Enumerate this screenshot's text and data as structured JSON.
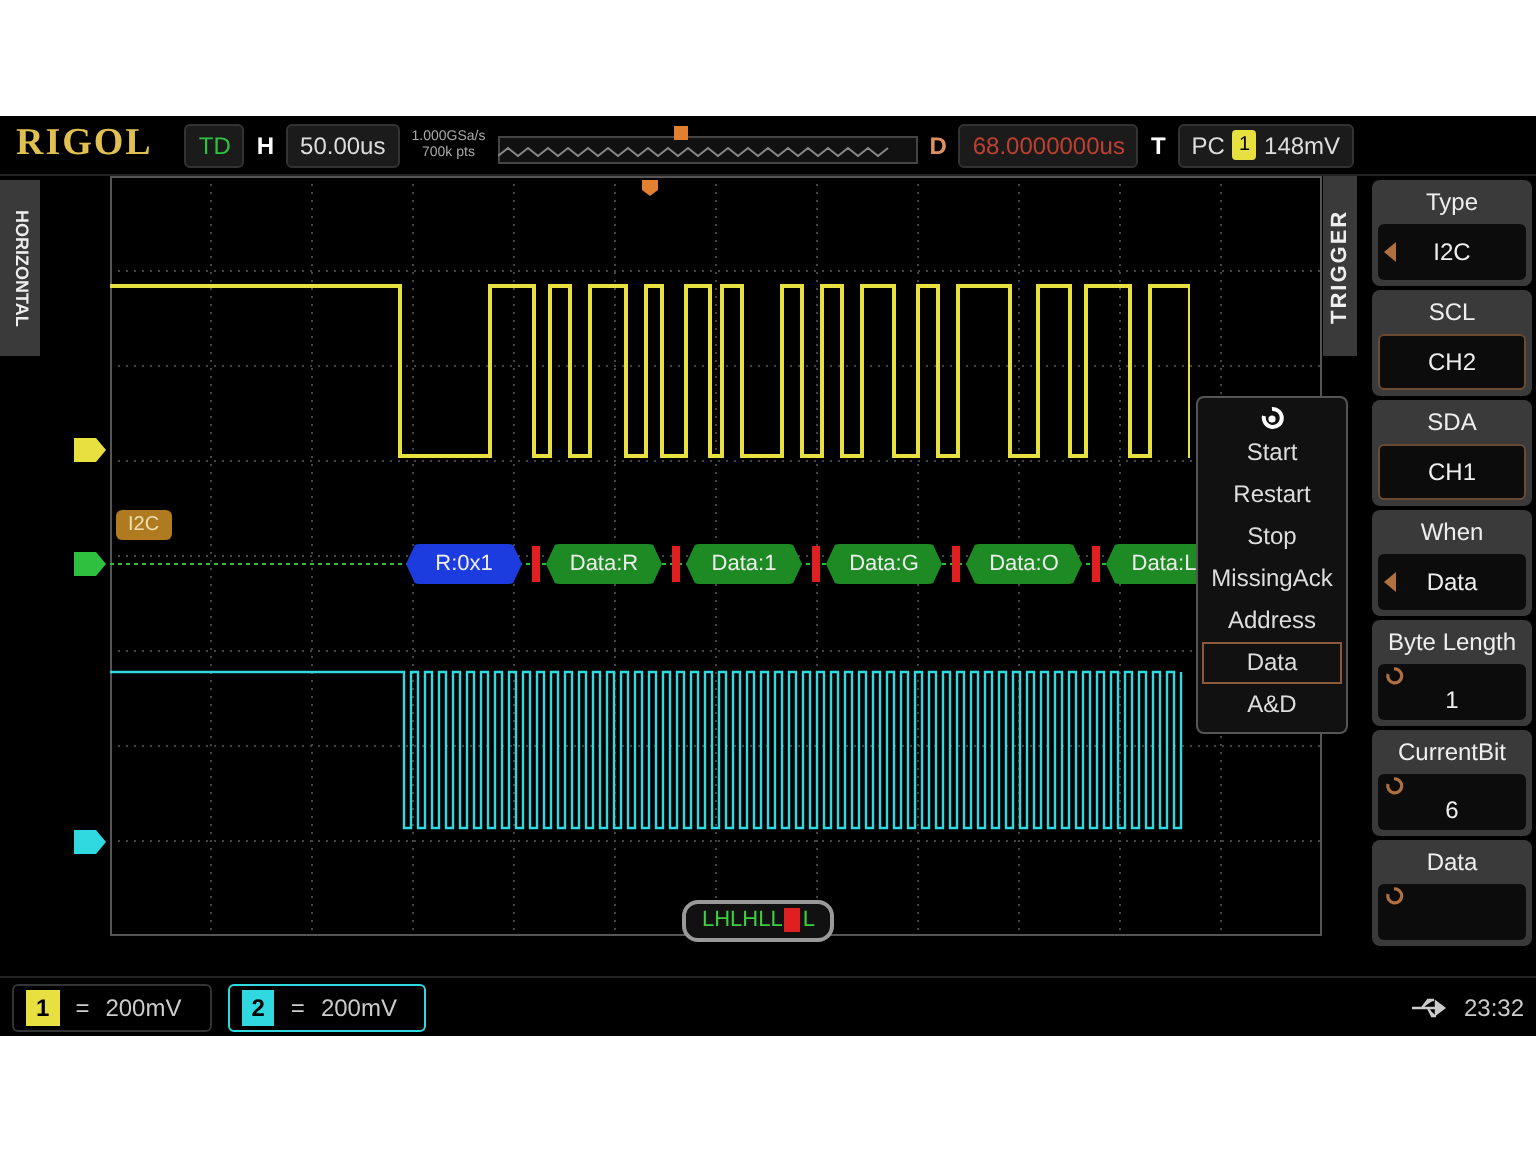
{
  "header": {
    "logo": "RIGOL",
    "run_status": "TD",
    "timebase_label": "H",
    "timebase": "50.00us",
    "sample_rate": "1.000GSa/s",
    "memory_depth": "700k pts",
    "delay_label": "D",
    "delay": "68.0000000us",
    "trigger_label": "T",
    "trigger_source": "PC",
    "trigger_channel": "1",
    "trigger_level": "148mV"
  },
  "side_tab": "HORIZONTAL",
  "bus": {
    "label": "I2C",
    "packets": [
      {
        "kind": "address",
        "text": "R:0x1"
      },
      {
        "kind": "data",
        "text": "Data:R"
      },
      {
        "kind": "data",
        "text": "Data:1"
      },
      {
        "kind": "data",
        "text": "Data:G"
      },
      {
        "kind": "data",
        "text": "Data:O"
      },
      {
        "kind": "data",
        "text": "Data:L"
      }
    ]
  },
  "bit_pattern": {
    "before": "LHLHLL",
    "after": "L"
  },
  "popup_menu": {
    "items": [
      {
        "label": "Start",
        "selected": false
      },
      {
        "label": "Restart",
        "selected": false
      },
      {
        "label": "Stop",
        "selected": false
      },
      {
        "label": "MissingAck",
        "selected": false
      },
      {
        "label": "Address",
        "selected": false
      },
      {
        "label": "Data",
        "selected": true
      },
      {
        "label": "A&D",
        "selected": false
      }
    ]
  },
  "menu": {
    "title": "TRIGGER",
    "softkeys": [
      {
        "kind": "select",
        "label": "Type",
        "value": "I2C"
      },
      {
        "kind": "plain",
        "label": "SCL",
        "value": "CH2"
      },
      {
        "kind": "plain",
        "label": "SDA",
        "value": "CH1"
      },
      {
        "kind": "select",
        "label": "When",
        "value": "Data"
      },
      {
        "kind": "knob",
        "label": "Byte Length",
        "value": "1"
      },
      {
        "kind": "knob",
        "label": "CurrentBit",
        "value": "6"
      },
      {
        "kind": "knob",
        "label": "Data"
      }
    ]
  },
  "channels": [
    {
      "number": "1",
      "separator": "=",
      "scale": "200mV",
      "color": "#e8e040",
      "selected": false
    },
    {
      "number": "2",
      "separator": "=",
      "scale": "200mV",
      "color": "#30d8e0",
      "selected": true
    }
  ],
  "status": {
    "time": "23:32"
  }
}
